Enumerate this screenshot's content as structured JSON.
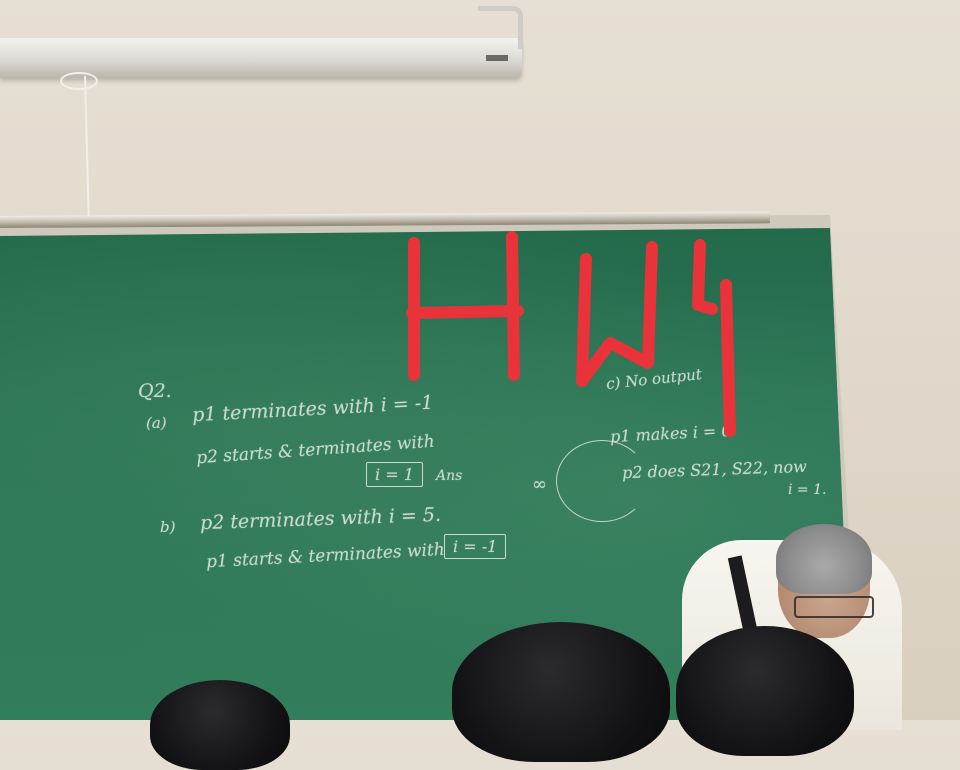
{
  "image": {
    "handwriting": {
      "q2": "Q2.",
      "a_label": "(a)",
      "a_line1": "p1 terminates with i = -1",
      "a_line2": "p2 starts & terminates with",
      "a_box": "i = 1",
      "a_ans": "Ans",
      "b_label": "b)",
      "b_line1": "p2 terminates with i = 5.",
      "b_line2": "p1 starts & terminates with",
      "b_box": "i = -1",
      "c_line1": "c) No output",
      "c_line2": "p1 makes i = 0",
      "c_line3": "p2 does S21, S22, now",
      "c_line4": "i = 1.",
      "infinity": "∞"
    },
    "red_annotation": "HW4",
    "colors": {
      "chalkboard_green": "#2c7656",
      "wall": "#e3dccf",
      "chalk": "#e9efe6",
      "red_ink": "#e8333b"
    }
  }
}
